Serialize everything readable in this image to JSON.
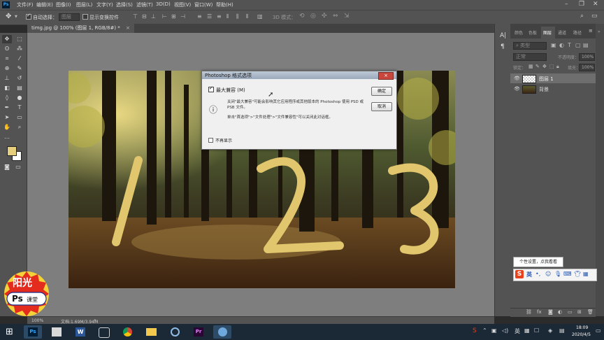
{
  "menubar": {
    "app_abbr": "Ps",
    "items": [
      "文件(F)",
      "编辑(E)",
      "图像(I)",
      "图层(L)",
      "文字(Y)",
      "选择(S)",
      "滤镜(T)",
      "3D(D)",
      "视图(V)",
      "窗口(W)",
      "帮助(H)"
    ]
  },
  "options": {
    "auto_select_label": "自动选择：",
    "auto_select_value": "图层",
    "show_transform_label": "显示变换控件",
    "mode_3d_label": "3D 模式："
  },
  "document": {
    "tab_title": "timg.jpg @ 100% (图层 1, RGB/8#) *",
    "status_zoom": "100%",
    "status_doc": "文档:1.69M/3.94M"
  },
  "dialog": {
    "title": "Photoshop 格式选项",
    "max_compat_label": "最大兼容 (M)",
    "message1": "关闭\"最大兼容\"可能会影响其它应用程序或其他版本的 Photoshop 使用 PSD 或 PSB 文件。",
    "message2": "单击\"首选项\">\"文件处理\">\"文件兼容性\"可以关闭此对话框。",
    "no_show_label": "不再显示",
    "ok_label": "确定",
    "cancel_label": "取消",
    "close_symbol": "×"
  },
  "panels": {
    "tabs": [
      "颜色",
      "色板",
      "图层",
      "通道",
      "路径"
    ],
    "filter_label": "类型",
    "blend_mode": "正常",
    "opacity_label": "不透明度：",
    "opacity_value": "100%",
    "lock_label": "锁定：",
    "fill_label": "填充：",
    "fill_value": "100%",
    "layers": [
      {
        "name": "图层 1"
      },
      {
        "name": "背景"
      }
    ]
  },
  "ime": {
    "tooltip": "个性设置，点我看看",
    "lang": "英"
  },
  "clock": {
    "time": "18:09",
    "date": "2020/4/5"
  },
  "logo": {
    "text_top": "阳光",
    "text_ps": "Ps",
    "text_class": "课堂"
  },
  "painted_numbers": [
    "1",
    "2",
    "3"
  ],
  "colors": {
    "foreground": "#e6cf7c",
    "paint": "#e1c66d"
  }
}
